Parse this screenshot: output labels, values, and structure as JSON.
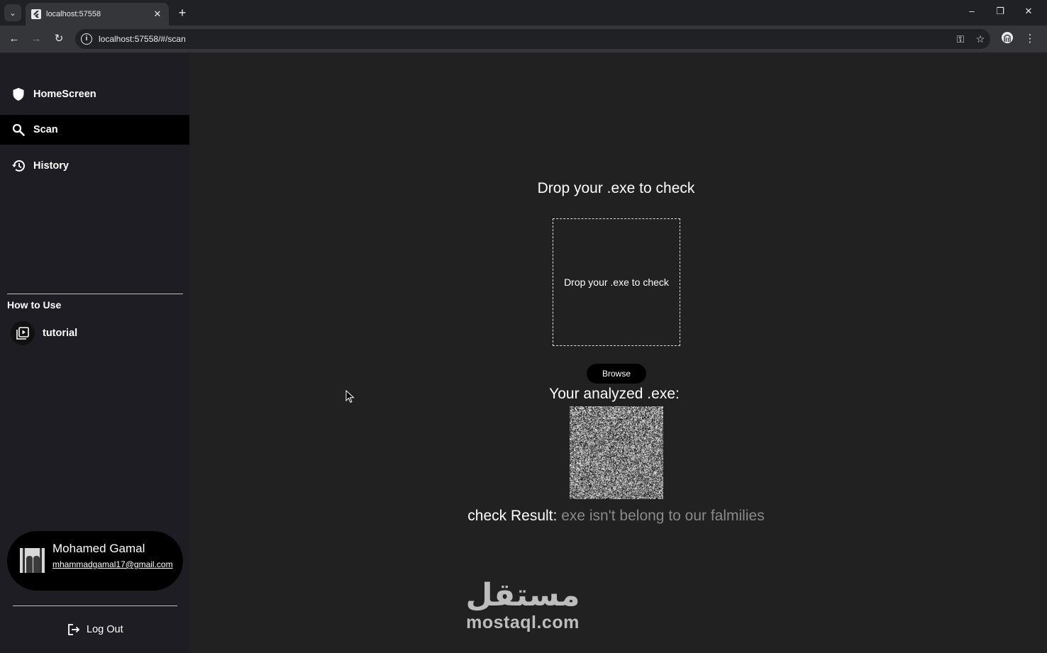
{
  "browser": {
    "tab_title": "localhost:57558",
    "tab_close": "✕",
    "new_tab": "+",
    "url": "localhost:57558/#/scan",
    "window_controls": {
      "minimize": "–",
      "restore": "❐",
      "close": "✕"
    }
  },
  "sidebar": {
    "items": [
      {
        "label": "HomeScreen",
        "icon": "shield-icon"
      },
      {
        "label": "Scan",
        "icon": "search-icon",
        "active": true
      },
      {
        "label": "History",
        "icon": "history-icon"
      }
    ],
    "section_title": "How to Use",
    "tutorial_label": "tutorial",
    "profile": {
      "name": "Mohamed Gamal",
      "email": "mhammadgamal17@gmail.com"
    },
    "logout_label": "Log Out"
  },
  "main": {
    "title": "Drop your .exe to check",
    "dropzone_text": "Drop your .exe to check",
    "browse_label": "Browse",
    "analyzed_label": "Your analyzed .exe:",
    "result_label": "check Result:",
    "result_value": "exe isn't belong to our falmilies"
  },
  "watermark": {
    "arabic": "مستقل",
    "text": "mostaql.com"
  },
  "colors": {
    "sidebar_bg": "#1f1d24",
    "main_bg": "#212121",
    "active_item": "#000000",
    "result_value": "#8a8a8a"
  }
}
